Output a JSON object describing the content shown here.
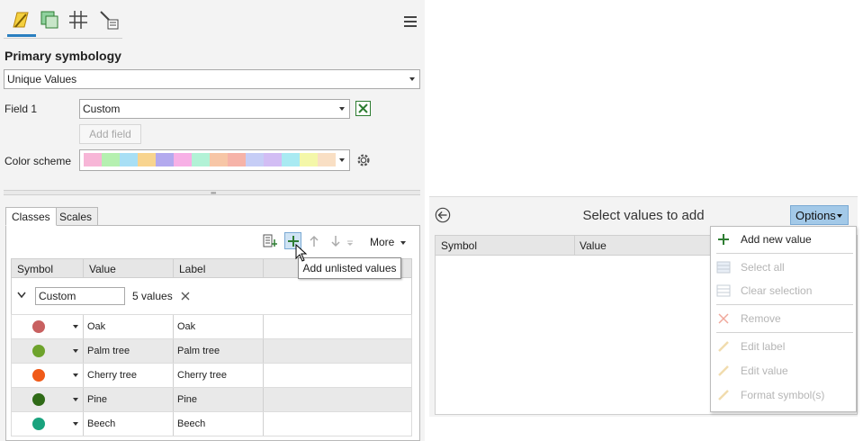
{
  "symbology": {
    "title": "Primary symbology",
    "method": "Unique Values",
    "field1_label": "Field 1",
    "field1_value": "Custom",
    "add_field_label": "Add field",
    "color_scheme_label": "Color scheme",
    "color_scheme_swatches": [
      "#f7b6d7",
      "#b5f0b0",
      "#a8dff5",
      "#f8d48f",
      "#b3a9ee",
      "#f7b0e6",
      "#b2f2d6",
      "#f7c6a6",
      "#f6b3a8",
      "#c6cdf6",
      "#d2bdf4",
      "#a9eaf2",
      "#f4f7a9",
      "#f9dfc4"
    ]
  },
  "tabs": [
    "Classes",
    "Scales"
  ],
  "toolbar": {
    "more_label": "More",
    "tooltip": "Add unlisted values"
  },
  "classes_table": {
    "columns": [
      "Symbol",
      "Value",
      "Label"
    ],
    "group_name": "Custom",
    "group_count": "5 values",
    "rows": [
      {
        "color": "#c86060",
        "value": "Oak",
        "label": "Oak"
      },
      {
        "color": "#6ea32c",
        "value": "Palm tree",
        "label": "Palm tree"
      },
      {
        "color": "#f05a18",
        "value": "Cherry tree",
        "label": "Cherry tree"
      },
      {
        "color": "#2f6a17",
        "value": "Pine",
        "label": "Pine"
      },
      {
        "color": "#1aa37e",
        "value": "Beech",
        "label": "Beech"
      }
    ]
  },
  "dialog": {
    "title": "Select values to add",
    "options_label": "Options",
    "columns": [
      "Symbol",
      "Value"
    ],
    "menu": [
      {
        "label": "Add new value",
        "enabled": true,
        "icon": "plus-icon"
      },
      {
        "label": "Select all",
        "enabled": false,
        "icon": "select-all-icon"
      },
      {
        "label": "Clear selection",
        "enabled": false,
        "icon": "clear-selection-icon"
      },
      {
        "label": "Remove",
        "enabled": false,
        "icon": "remove-icon"
      },
      {
        "label": "Edit label",
        "enabled": false,
        "icon": "pencil-icon"
      },
      {
        "label": "Edit value",
        "enabled": false,
        "icon": "pencil-icon"
      },
      {
        "label": "Format symbol(s)",
        "enabled": false,
        "icon": "pencil-icon"
      }
    ]
  },
  "colors": {
    "accent": "#2a7fc0",
    "options_button": "#a3c9e8"
  }
}
